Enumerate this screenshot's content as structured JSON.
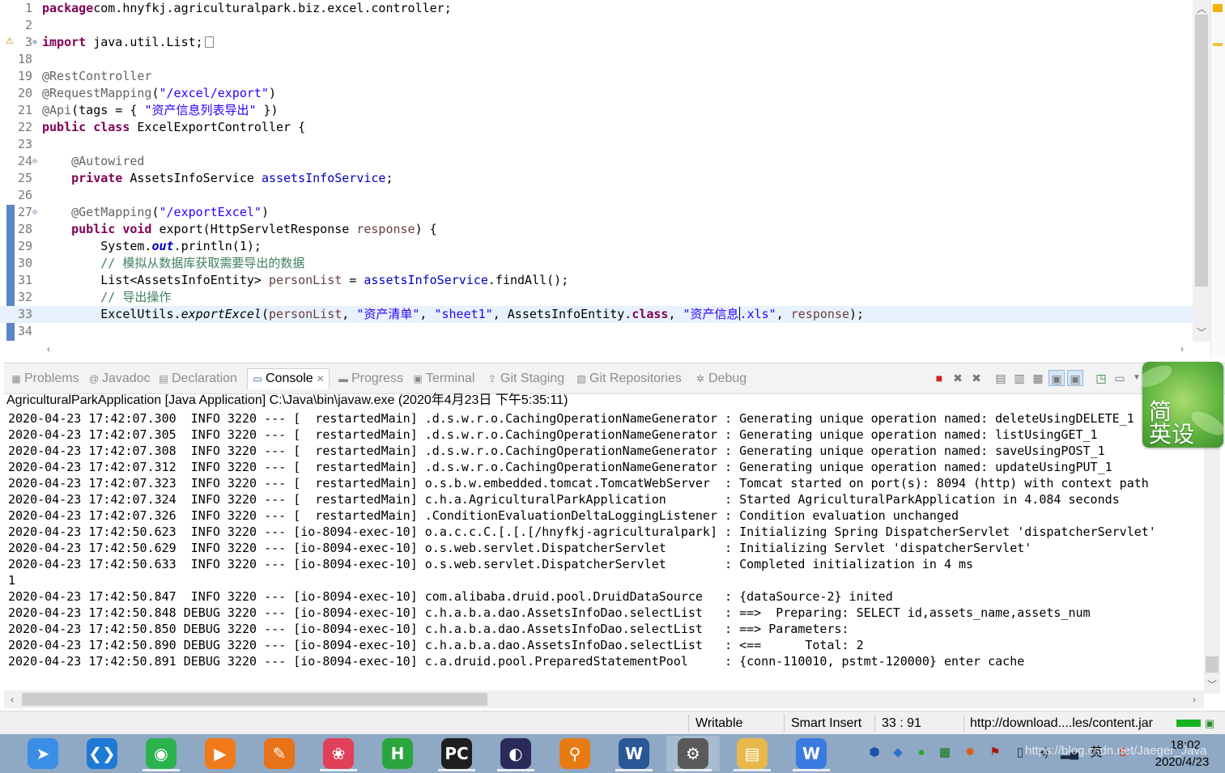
{
  "editor": {
    "lines": [
      {
        "n": "1",
        "parts": [
          [
            "kw",
            "package"
          ],
          [
            "",
            "com.hnyfkj.agriculturalpark.biz.excel.controller;"
          ]
        ]
      },
      {
        "n": "2",
        "parts": []
      },
      {
        "n": "3",
        "fold": "⊕",
        "parts": [
          [
            "kw",
            "import"
          ],
          [
            "",
            " java.util.List;"
          ]
        ],
        "collapsed": true
      },
      {
        "n": "18",
        "parts": []
      },
      {
        "n": "19",
        "parts": [
          [
            "ann",
            "@RestController"
          ]
        ]
      },
      {
        "n": "20",
        "parts": [
          [
            "ann",
            "@RequestMapping"
          ],
          [
            "",
            "("
          ],
          [
            "str",
            "\"/excel/export\""
          ],
          [
            "",
            ")"
          ]
        ]
      },
      {
        "n": "21",
        "parts": [
          [
            "ann",
            "@Api"
          ],
          [
            "",
            "(tags = { "
          ],
          [
            "str",
            "\"资产信息列表导出\""
          ],
          [
            "",
            " })"
          ]
        ]
      },
      {
        "n": "22",
        "parts": [
          [
            "kw",
            "public"
          ],
          [
            "",
            " "
          ],
          [
            "kw",
            "class"
          ],
          [
            "",
            " ExcelExportController {"
          ]
        ]
      },
      {
        "n": "23",
        "parts": []
      },
      {
        "n": "24",
        "fold": "⊖",
        "parts": [
          [
            "",
            "    "
          ],
          [
            "ann",
            "@Autowired"
          ]
        ]
      },
      {
        "n": "25",
        "parts": [
          [
            "",
            "    "
          ],
          [
            "kw",
            "private"
          ],
          [
            "",
            " AssetsInfoService "
          ],
          [
            "field",
            "assetsInfoService"
          ],
          [
            "",
            ";"
          ]
        ]
      },
      {
        "n": "26",
        "parts": []
      },
      {
        "n": "27",
        "fold": "⊖",
        "parts": [
          [
            "",
            "    "
          ],
          [
            "ann",
            "@GetMapping"
          ],
          [
            "",
            "("
          ],
          [
            "str",
            "\"/exportExcel\""
          ],
          [
            "",
            ")"
          ]
        ]
      },
      {
        "n": "28",
        "parts": [
          [
            "",
            "    "
          ],
          [
            "kw",
            "public"
          ],
          [
            "",
            " "
          ],
          [
            "kw",
            "void"
          ],
          [
            "",
            " export(HttpServletResponse "
          ],
          [
            "param",
            "response"
          ],
          [
            "",
            ") {"
          ]
        ]
      },
      {
        "n": "29",
        "parts": [
          [
            "",
            "        System."
          ],
          [
            "statfld",
            "out"
          ],
          [
            "",
            ".println(1);"
          ]
        ]
      },
      {
        "n": "30",
        "parts": [
          [
            "cmt",
            "        // 模拟从数据库获取需要导出的数据"
          ]
        ]
      },
      {
        "n": "31",
        "parts": [
          [
            "",
            "        List<AssetsInfoEntity> "
          ],
          [
            "param",
            "personList"
          ],
          [
            "",
            " = "
          ],
          [
            "field",
            "assetsInfoService"
          ],
          [
            "",
            ".findAll();"
          ]
        ]
      },
      {
        "n": "32",
        "parts": [
          [
            "cmt",
            "        // 导出操作"
          ]
        ]
      },
      {
        "n": "33",
        "current": true,
        "parts": [
          [
            "",
            "        ExcelUtils."
          ],
          [
            "ital",
            "exportExcel"
          ],
          [
            "",
            "("
          ],
          [
            "param",
            "personList"
          ],
          [
            "",
            ", "
          ],
          [
            "str",
            "\"资产清单\""
          ],
          [
            "",
            ", "
          ],
          [
            "str",
            "\"sheet1\""
          ],
          [
            "",
            ", AssetsInfoEntity."
          ],
          [
            "kw",
            "class"
          ],
          [
            "",
            ", "
          ],
          [
            "str",
            "\"资产信息"
          ],
          [
            "cursor",
            ""
          ],
          [
            "str",
            ".xls\""
          ],
          [
            "",
            ", "
          ],
          [
            "param",
            "response"
          ],
          [
            "",
            ");"
          ]
        ]
      },
      {
        "n": "34",
        "parts": []
      }
    ]
  },
  "panel": {
    "tabs": [
      {
        "label": "Problems",
        "icon": "problems-icon",
        "glyph": "▦"
      },
      {
        "label": "Javadoc",
        "icon": "at-icon",
        "glyph": "@"
      },
      {
        "label": "Declaration",
        "icon": "declaration-icon",
        "glyph": "▤"
      },
      {
        "label": "Console",
        "icon": "console-icon",
        "glyph": "▭",
        "active": true,
        "close": "✕"
      },
      {
        "label": "Progress",
        "icon": "progress-icon",
        "glyph": "▬"
      },
      {
        "label": "Terminal",
        "icon": "terminal-icon",
        "glyph": "▣"
      },
      {
        "label": "Git Staging",
        "icon": "git-staging-icon",
        "glyph": "⇪"
      },
      {
        "label": "Git Repositories",
        "icon": "git-repositories-icon",
        "glyph": "▧"
      },
      {
        "label": "Debug",
        "icon": "debug-icon",
        "glyph": "✲"
      }
    ],
    "launch_title": "AgriculturalParkApplication [Java Application] C:\\Java\\bin\\javaw.exe (2020年4月23日 下午5:35:11)",
    "log_lines": [
      "2020-04-23 17:42:07.300  INFO 3220 --- [  restartedMain] .d.s.w.r.o.CachingOperationNameGenerator : Generating unique operation named: deleteUsingDELETE_1",
      "2020-04-23 17:42:07.305  INFO 3220 --- [  restartedMain] .d.s.w.r.o.CachingOperationNameGenerator : Generating unique operation named: listUsingGET_1",
      "2020-04-23 17:42:07.308  INFO 3220 --- [  restartedMain] .d.s.w.r.o.CachingOperationNameGenerator : Generating unique operation named: saveUsingPOST_1",
      "2020-04-23 17:42:07.312  INFO 3220 --- [  restartedMain] .d.s.w.r.o.CachingOperationNameGenerator : Generating unique operation named: updateUsingPUT_1",
      "2020-04-23 17:42:07.323  INFO 3220 --- [  restartedMain] o.s.b.w.embedded.tomcat.TomcatWebServer  : Tomcat started on port(s): 8094 (http) with context path",
      "2020-04-23 17:42:07.324  INFO 3220 --- [  restartedMain] c.h.a.AgriculturalParkApplication        : Started AgriculturalParkApplication in 4.084 seconds",
      "2020-04-23 17:42:07.326  INFO 3220 --- [  restartedMain] .ConditionEvaluationDeltaLoggingListener : Condition evaluation unchanged",
      "2020-04-23 17:42:50.623  INFO 3220 --- [io-8094-exec-10] o.a.c.c.C.[.[.[/hnyfkj-agriculturalpark] : Initializing Spring DispatcherServlet 'dispatcherServlet'",
      "2020-04-23 17:42:50.629  INFO 3220 --- [io-8094-exec-10] o.s.web.servlet.DispatcherServlet        : Initializing Servlet 'dispatcherServlet'",
      "2020-04-23 17:42:50.633  INFO 3220 --- [io-8094-exec-10] o.s.web.servlet.DispatcherServlet        : Completed initialization in 4 ms",
      "1",
      "2020-04-23 17:42:50.847  INFO 3220 --- [io-8094-exec-10] com.alibaba.druid.pool.DruidDataSource   : {dataSource-2} inited",
      "2020-04-23 17:42:50.848 DEBUG 3220 --- [io-8094-exec-10] c.h.a.b.a.dao.AssetsInfoDao.selectList   : ==>  Preparing: SELECT id,assets_name,assets_num",
      "2020-04-23 17:42:50.850 DEBUG 3220 --- [io-8094-exec-10] c.h.a.b.a.dao.AssetsInfoDao.selectList   : ==> Parameters: ",
      "2020-04-23 17:42:50.890 DEBUG 3220 --- [io-8094-exec-10] c.h.a.b.a.dao.AssetsInfoDao.selectList   : <==      Total: 2",
      "2020-04-23 17:42:50.891 DEBUG 3220 --- [io-8094-exec-10] c.a.druid.pool.PreparedStatementPool     : {conn-110010, pstmt-120000} enter cache"
    ]
  },
  "ime_widget": {
    "line1": "简",
    "line2": "英设"
  },
  "status": {
    "mode": "Writable",
    "insert": "Smart Insert",
    "position": "33 : 91",
    "download": "http://download....les/content.jar"
  },
  "taskbar": {
    "apps": [
      "messenger-icon",
      "vscode-icon",
      "wechat-icon",
      "video-player-icon",
      "pen-icon",
      "color-app-icon",
      "hbuilder-icon",
      "pycharm-icon",
      "eclipse-icon",
      "search-app-icon",
      "word-icon",
      "java-ee-ide-icon",
      "file-explorer-icon",
      "wps-icon"
    ],
    "tray_ime": "英",
    "time": "18:02",
    "date": "2020/4/23"
  },
  "watermark": "https://blog.csdn.net/Jaeger_Java",
  "colors": {
    "keyword": "#7f0055",
    "string": "#2a00ff",
    "annotation": "#646464",
    "field": "#0000c0",
    "comment": "#3f7f5f",
    "param": "#6a3e3e"
  }
}
